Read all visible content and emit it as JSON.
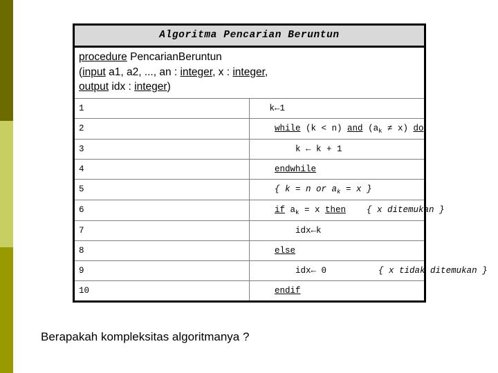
{
  "slide": {
    "background_color": "#ffffff",
    "question": "Berapakah kompleksitas algoritmanya ?"
  },
  "sidebar": {
    "bands": [
      {
        "name": "band-top",
        "color": "#6b6b00"
      },
      {
        "name": "band-mid",
        "color": "#c8cf62"
      },
      {
        "name": "band-bottom",
        "color": "#999a00"
      }
    ]
  },
  "algorithm": {
    "title": "Algoritma Pencarian Beruntun",
    "title_background": "#d9d9d9",
    "signature": {
      "line1_keyword": "procedure",
      "line1_name": " PencarianBeruntun",
      "line2_prefix": "(",
      "line2_keyword": "input",
      "line2_params": " a1, a2, ..., an : ",
      "line2_type1": "integer",
      "line2_mid": ", x : ",
      "line2_type2": "integer",
      "line2_suffix": ",",
      "line3_prefix": " ",
      "line3_keyword": "output",
      "line3_params": " idx : ",
      "line3_type": "integer",
      "line3_suffix": ")"
    },
    "rows": [
      {
        "num": "1",
        "indent": "   ",
        "segments": [
          {
            "text": "k←1",
            "style": "plain"
          }
        ]
      },
      {
        "num": "2",
        "indent": "    ",
        "segments": [
          {
            "text": "while",
            "style": "keyword"
          },
          {
            "text": " (k < n) ",
            "style": "plain"
          },
          {
            "text": "and",
            "style": "keyword"
          },
          {
            "text": " (a",
            "style": "plain"
          },
          {
            "text": "k",
            "style": "subscript"
          },
          {
            "text": " ≠ x) ",
            "style": "plain"
          },
          {
            "text": "do",
            "style": "keyword"
          }
        ]
      },
      {
        "num": "3",
        "indent": "        ",
        "segments": [
          {
            "text": "k ← k + 1",
            "style": "plain"
          }
        ]
      },
      {
        "num": "4",
        "indent": "    ",
        "segments": [
          {
            "text": "endwhile",
            "style": "keyword"
          }
        ]
      },
      {
        "num": "5",
        "indent": "    ",
        "segments": [
          {
            "text": "{ k = n or a",
            "style": "italic"
          },
          {
            "text": "k",
            "style": "subscript-italic"
          },
          {
            "text": " = x }",
            "style": "italic"
          }
        ]
      },
      {
        "num": "6",
        "indent": "    ",
        "segments": [
          {
            "text": "if",
            "style": "keyword"
          },
          {
            "text": " a",
            "style": "plain"
          },
          {
            "text": "k",
            "style": "subscript"
          },
          {
            "text": " = x ",
            "style": "plain"
          },
          {
            "text": "then",
            "style": "keyword"
          },
          {
            "text": "    ",
            "style": "plain"
          },
          {
            "text": "{ x ditemukan }",
            "style": "italic"
          }
        ]
      },
      {
        "num": "7",
        "indent": "        ",
        "segments": [
          {
            "text": "idx←k",
            "style": "plain"
          }
        ]
      },
      {
        "num": "8",
        "indent": "    ",
        "segments": [
          {
            "text": "else",
            "style": "keyword"
          }
        ]
      },
      {
        "num": "9",
        "indent": "        ",
        "segments": [
          {
            "text": "idx← 0",
            "style": "plain"
          },
          {
            "text": "          ",
            "style": "plain"
          },
          {
            "text": "{ x tidak ditemukan }",
            "style": "italic"
          }
        ]
      },
      {
        "num": "10",
        "indent": "    ",
        "segments": [
          {
            "text": "endif",
            "style": "keyword"
          }
        ]
      }
    ]
  }
}
